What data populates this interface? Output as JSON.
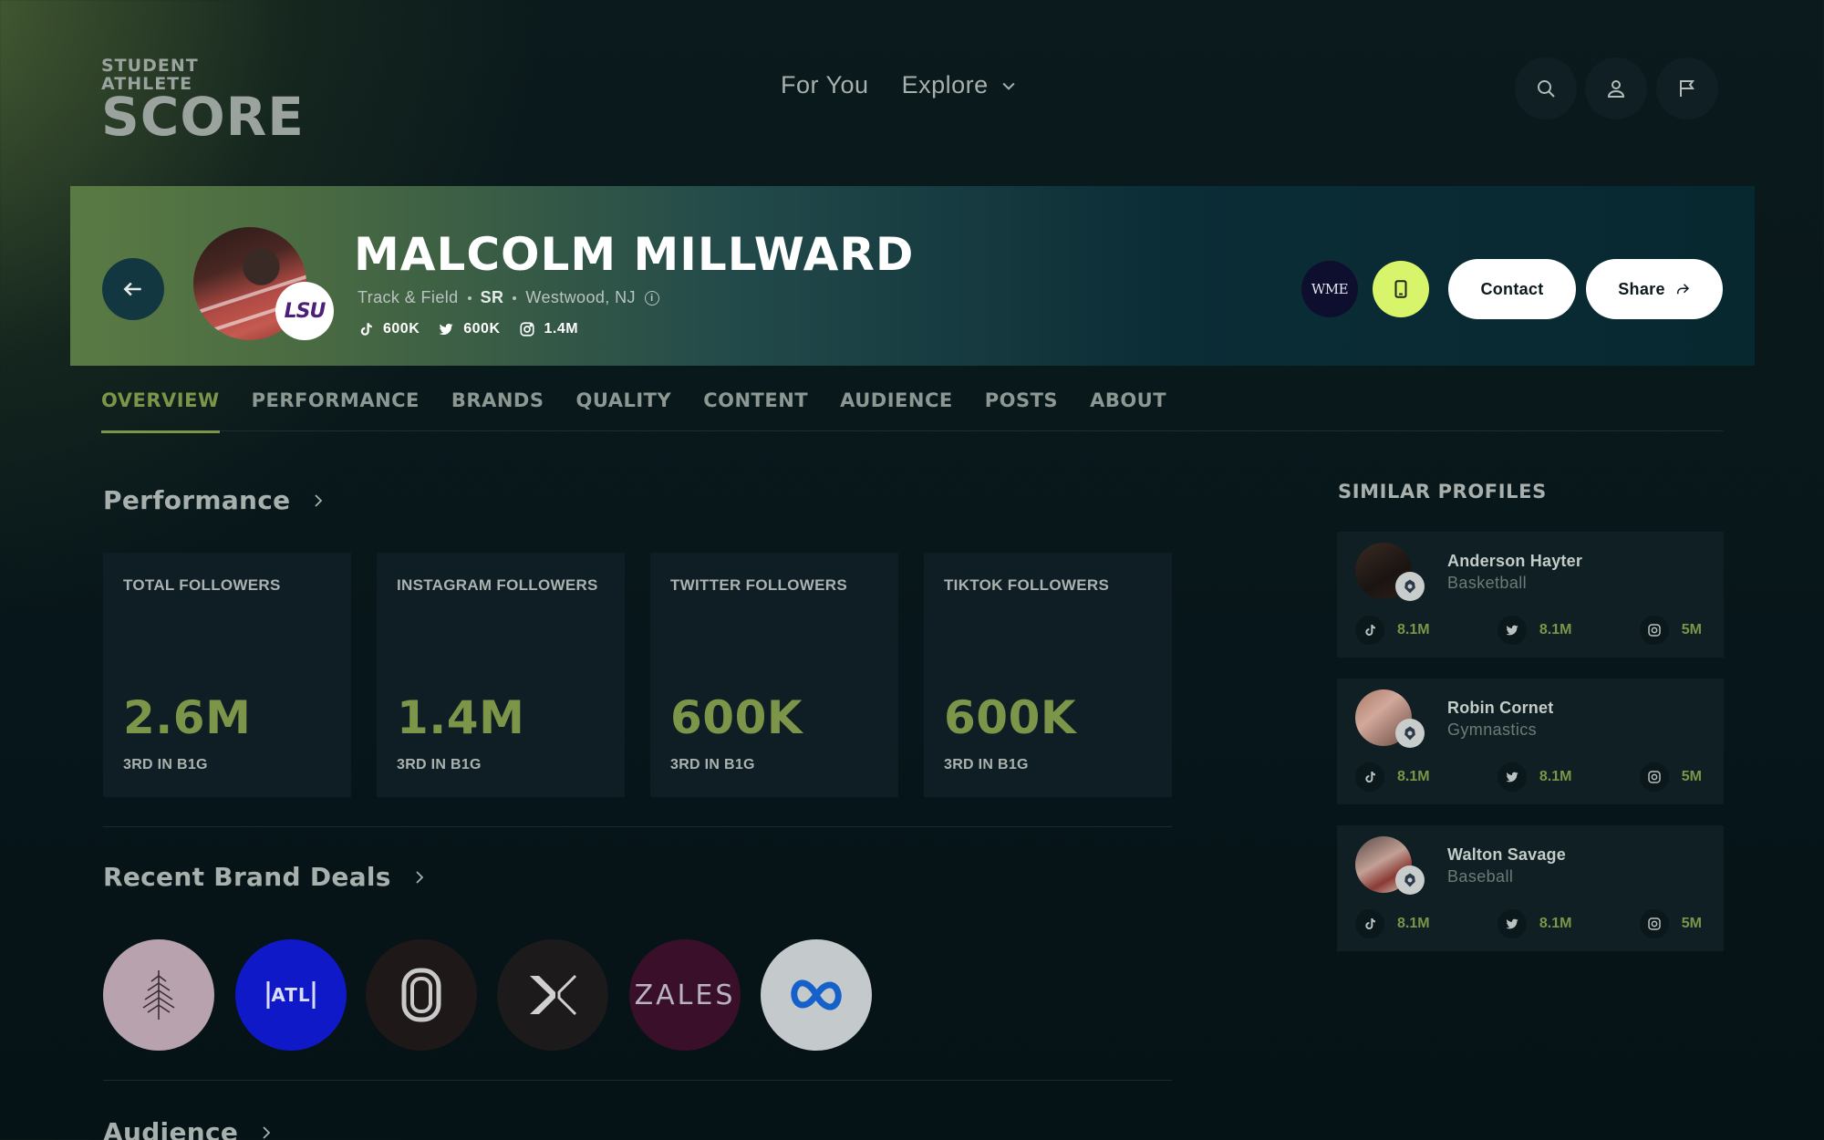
{
  "app": {
    "logo_small": "STUDENT ATHLETE",
    "logo_big": "SCORE"
  },
  "nav": {
    "for_you": "For You",
    "explore": "Explore"
  },
  "athlete": {
    "name": "MALCOLM MILLWARD",
    "sport": "Track & Field",
    "year": "SR",
    "location": "Westwood, NJ",
    "school_badge": "LSU",
    "agency_badge": "WME",
    "tiktok": "600K",
    "twitter": "600K",
    "instagram": "1.4M"
  },
  "actions": {
    "contact": "Contact",
    "share": "Share"
  },
  "tabs": [
    "OVERVIEW",
    "PERFORMANCE",
    "BRANDS",
    "QUALITY",
    "CONTENT",
    "AUDIENCE",
    "POSTS",
    "ABOUT"
  ],
  "active_tab": "OVERVIEW",
  "performance": {
    "title": "Performance",
    "cards": [
      {
        "label": "TOTAL FOLLOWERS",
        "value": "2.6M",
        "rank": "3RD IN B1G"
      },
      {
        "label": "INSTAGRAM FOLLOWERS",
        "value": "1.4M",
        "rank": "3RD IN B1G"
      },
      {
        "label": "TWITTER FOLLOWERS",
        "value": "600K",
        "rank": "3RD IN B1G"
      },
      {
        "label": "TIKTOK FOLLOWERS",
        "value": "600K",
        "rank": "3RD IN B1G"
      }
    ]
  },
  "brand_deals": {
    "title": "Recent Brand Deals",
    "brands": [
      {
        "name": "tree-logo",
        "bg": "#b8a2ad"
      },
      {
        "name": "atl-logo",
        "text": "ATL",
        "bg": "#1019c8"
      },
      {
        "name": "ring-logo",
        "bg": "#1f1818"
      },
      {
        "name": "x-logo",
        "bg": "#1c1a1a"
      },
      {
        "name": "zales-logo",
        "text": "ZALES",
        "bg": "#3a0f2a"
      },
      {
        "name": "meta-logo",
        "bg": "#c4c9cc"
      }
    ]
  },
  "audience": {
    "title": "Audience"
  },
  "similar": {
    "title": "SIMILAR PROFILES",
    "profiles": [
      {
        "name": "Anderson Hayter",
        "sport": "Basketball",
        "tiktok": "8.1M",
        "twitter": "8.1M",
        "instagram": "5M"
      },
      {
        "name": "Robin Cornet",
        "sport": "Gymnastics",
        "tiktok": "8.1M",
        "twitter": "8.1M",
        "instagram": "5M"
      },
      {
        "name": "Walton Savage",
        "sport": "Baseball",
        "tiktok": "8.1M",
        "twitter": "8.1M",
        "instagram": "5M"
      }
    ]
  },
  "colors": {
    "accent": "#7c9548",
    "phone_button": "#d8f46a",
    "card_bg": "#0e1e24"
  }
}
